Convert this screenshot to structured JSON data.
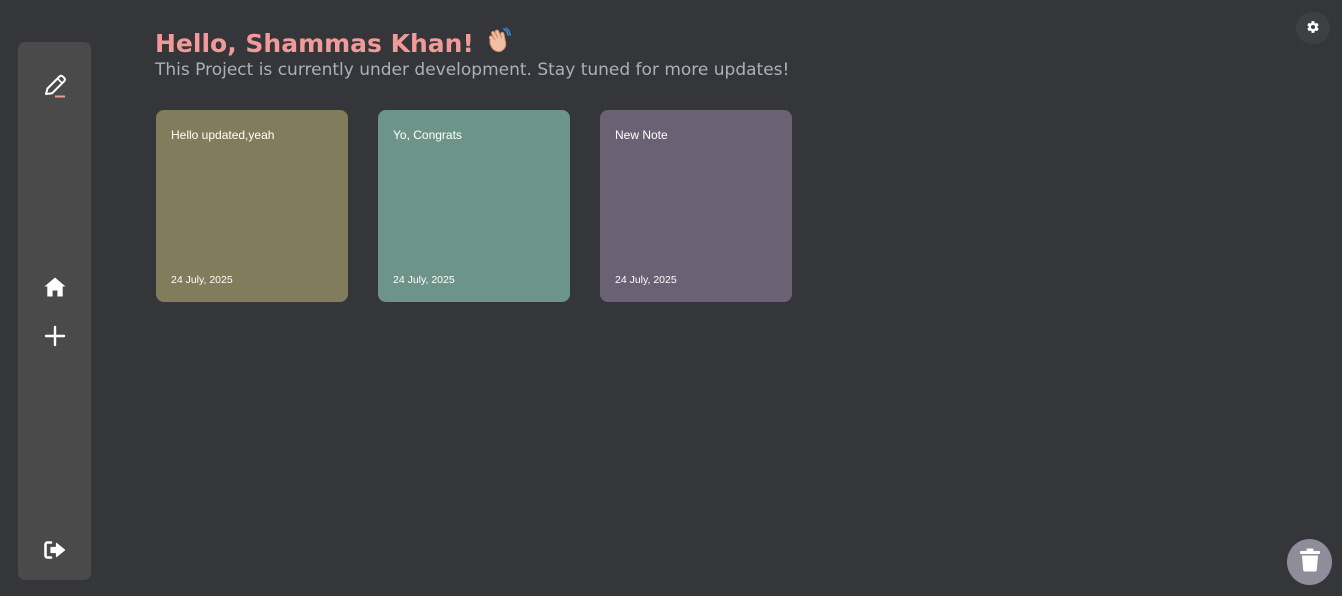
{
  "header": {
    "greeting": "Hello, Shammas Khan!",
    "subtitle": "This Project is currently under development. Stay tuned for more updates!"
  },
  "sidebar": {
    "items": [
      {
        "icon": "pen-icon"
      },
      {
        "icon": "home-icon"
      },
      {
        "icon": "plus-icon"
      },
      {
        "icon": "logout-icon"
      }
    ]
  },
  "notes": [
    {
      "title": "Hello updated,yeah",
      "date": "24 July, 2025",
      "color": "#817c5b"
    },
    {
      "title": "Yo, Congrats",
      "date": "24 July, 2025",
      "color": "#6d9488"
    },
    {
      "title": "New Note",
      "date": "24 July, 2025",
      "color": "#6a6274"
    }
  ],
  "colors": {
    "background": "#35363a",
    "sidebar": "#4a4a4a",
    "accent": "#f2999a",
    "subtitle": "#a9b1be",
    "trash_button": "#8f8d99"
  }
}
